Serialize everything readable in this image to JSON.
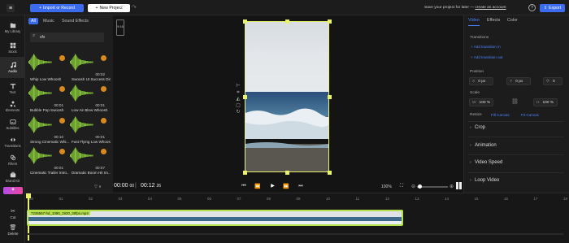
{
  "topbar": {
    "import_label": "Import or Record",
    "new_project_label": "New Project",
    "save_note": "Save your project for later —",
    "create_account_label": "create an account",
    "export_label": "Export"
  },
  "rail": [
    {
      "label": "My Library",
      "icon": "folder-icon"
    },
    {
      "label": "Stock",
      "icon": "grid-icon"
    },
    {
      "label": "Audio",
      "icon": "music-icon"
    },
    {
      "label": "Text",
      "icon": "text-icon"
    },
    {
      "label": "Elements",
      "icon": "shapes-icon"
    },
    {
      "label": "Subtitles",
      "icon": "subtitles-icon"
    },
    {
      "label": "Transitions",
      "icon": "transitions-icon"
    },
    {
      "label": "Filters",
      "icon": "filters-icon"
    },
    {
      "label": "Brand Kit",
      "icon": "brand-kit-icon"
    }
  ],
  "library": {
    "tabs": [
      "All",
      "Music",
      "Sound Effects"
    ],
    "search_value": "sfx",
    "sort_label": "▽  ∨"
  },
  "sounds": [
    {
      "name": "Whip Low Whoosh",
      "duration": ""
    },
    {
      "name": "Swoosh UI Success Din...",
      "duration": "00:02"
    },
    {
      "name": "Bubble Pop Swoosh",
      "duration": "00:01"
    },
    {
      "name": "Low Air Blow Whoosh",
      "duration": "00:01"
    },
    {
      "name": "Strong Cinematic Whi...",
      "duration": "00:10"
    },
    {
      "name": "Fast Flying Low Whoos...",
      "duration": "00:01"
    },
    {
      "name": "Cinematic Trailer Intro...",
      "duration": "00:01"
    },
    {
      "name": "Dramatic Boom Hit Im...",
      "duration": "00:07"
    }
  ],
  "preview": {
    "aspect_label": "9:16",
    "time_current": "00:00",
    "time_current_frames": "00",
    "time_total": "00:12",
    "time_total_frames": "26",
    "zoom_label": "100%"
  },
  "right": {
    "tabs": [
      "Video",
      "Effects",
      "Color"
    ],
    "transitions_heading": "Transitions",
    "add_in": "+ Add transition in",
    "add_out": "+ Add transition out",
    "position_heading": "Position",
    "x_key": "X",
    "x_value": "0 px",
    "y_key": "Y",
    "y_value": "0 px",
    "rotation_value": "0",
    "scale_heading": "Scale",
    "w_key": "W",
    "w_value": "100 %",
    "h_key": "H",
    "h_value": "100 %",
    "resize_label": "Resize",
    "fill_canvas": "Fill Canvas",
    "fit_canvas": "Fit Canvas",
    "sections": [
      "Crop",
      "Animation",
      "Video Speed",
      "Loop Video"
    ]
  },
  "timeline": {
    "ticks": [
      "00",
      "01",
      "02",
      "03",
      "04",
      "05",
      "06",
      "07",
      "08",
      "09",
      "10",
      "11",
      "12",
      "13",
      "14",
      "15",
      "16",
      "17",
      "18",
      "19"
    ],
    "clip_name": "7235557-hd_1080_1920_30fps.mp4",
    "cut_label": "Cut",
    "delete_label": "Delete"
  },
  "colors": {
    "accent": "#3b6cf0",
    "wave": "#8fd63c",
    "clip_border": "#b4e04a",
    "selection": "#e8f26a"
  }
}
